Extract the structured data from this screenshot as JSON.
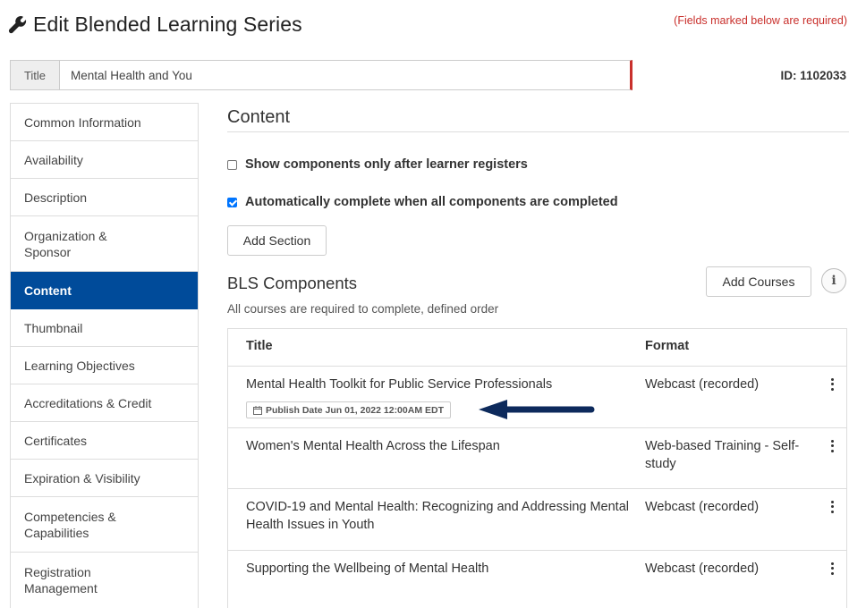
{
  "header": {
    "title": "Edit Blended Learning Series",
    "icon": "wrench-icon",
    "required_note": "(Fields marked below are required)"
  },
  "title_field": {
    "label": "Title",
    "value": "Mental Health and You"
  },
  "id_label": "ID: 1102033",
  "sidebar": {
    "items": [
      {
        "label": "Common Information",
        "active": false
      },
      {
        "label": "Availability",
        "active": false
      },
      {
        "label": "Description",
        "active": false
      },
      {
        "label": "Organization & Sponsor",
        "active": false
      },
      {
        "label": "Content",
        "active": true
      },
      {
        "label": "Thumbnail",
        "active": false
      },
      {
        "label": "Learning Objectives",
        "active": false
      },
      {
        "label": "Accreditations & Credit",
        "active": false
      },
      {
        "label": "Certificates",
        "active": false
      },
      {
        "label": "Expiration & Visibility",
        "active": false
      },
      {
        "label": "Competencies & Capabilities",
        "active": false
      },
      {
        "label": "Registration Management",
        "active": false
      }
    ]
  },
  "content": {
    "title": "Content",
    "options": [
      {
        "label": "Show components only after learner registers",
        "checked": false
      },
      {
        "label": "Automatically complete when all components are completed",
        "checked": true
      }
    ],
    "add_section_label": "Add Section"
  },
  "bls": {
    "title": "BLS Components",
    "subtitle": "All courses are required to complete, defined order",
    "add_courses_label": "Add Courses",
    "info_icon": "info-icon",
    "table": {
      "headers": [
        "Title",
        "Format"
      ],
      "rows": [
        {
          "title": "Mental Health Toolkit for Public Service Professionals",
          "format": "Webcast (recorded)",
          "badge": "Publish Date Jun 01, 2022 12:00AM EDT"
        },
        {
          "title": "Women's Mental Health Across the Lifespan",
          "format": "Web-based Training - Self-study"
        },
        {
          "title": "COVID-19 and Mental Health: Recognizing and Addressing Mental Health Issues in Youth",
          "format": "Webcast (recorded)"
        },
        {
          "title": "Supporting the Wellbeing of Mental Health",
          "format": "Webcast (recorded)"
        }
      ]
    }
  },
  "colors": {
    "active_nav": "#004b9a",
    "required": "#c9302c",
    "arrow": "#0d2a5c",
    "checkbox": "#0075ff"
  }
}
